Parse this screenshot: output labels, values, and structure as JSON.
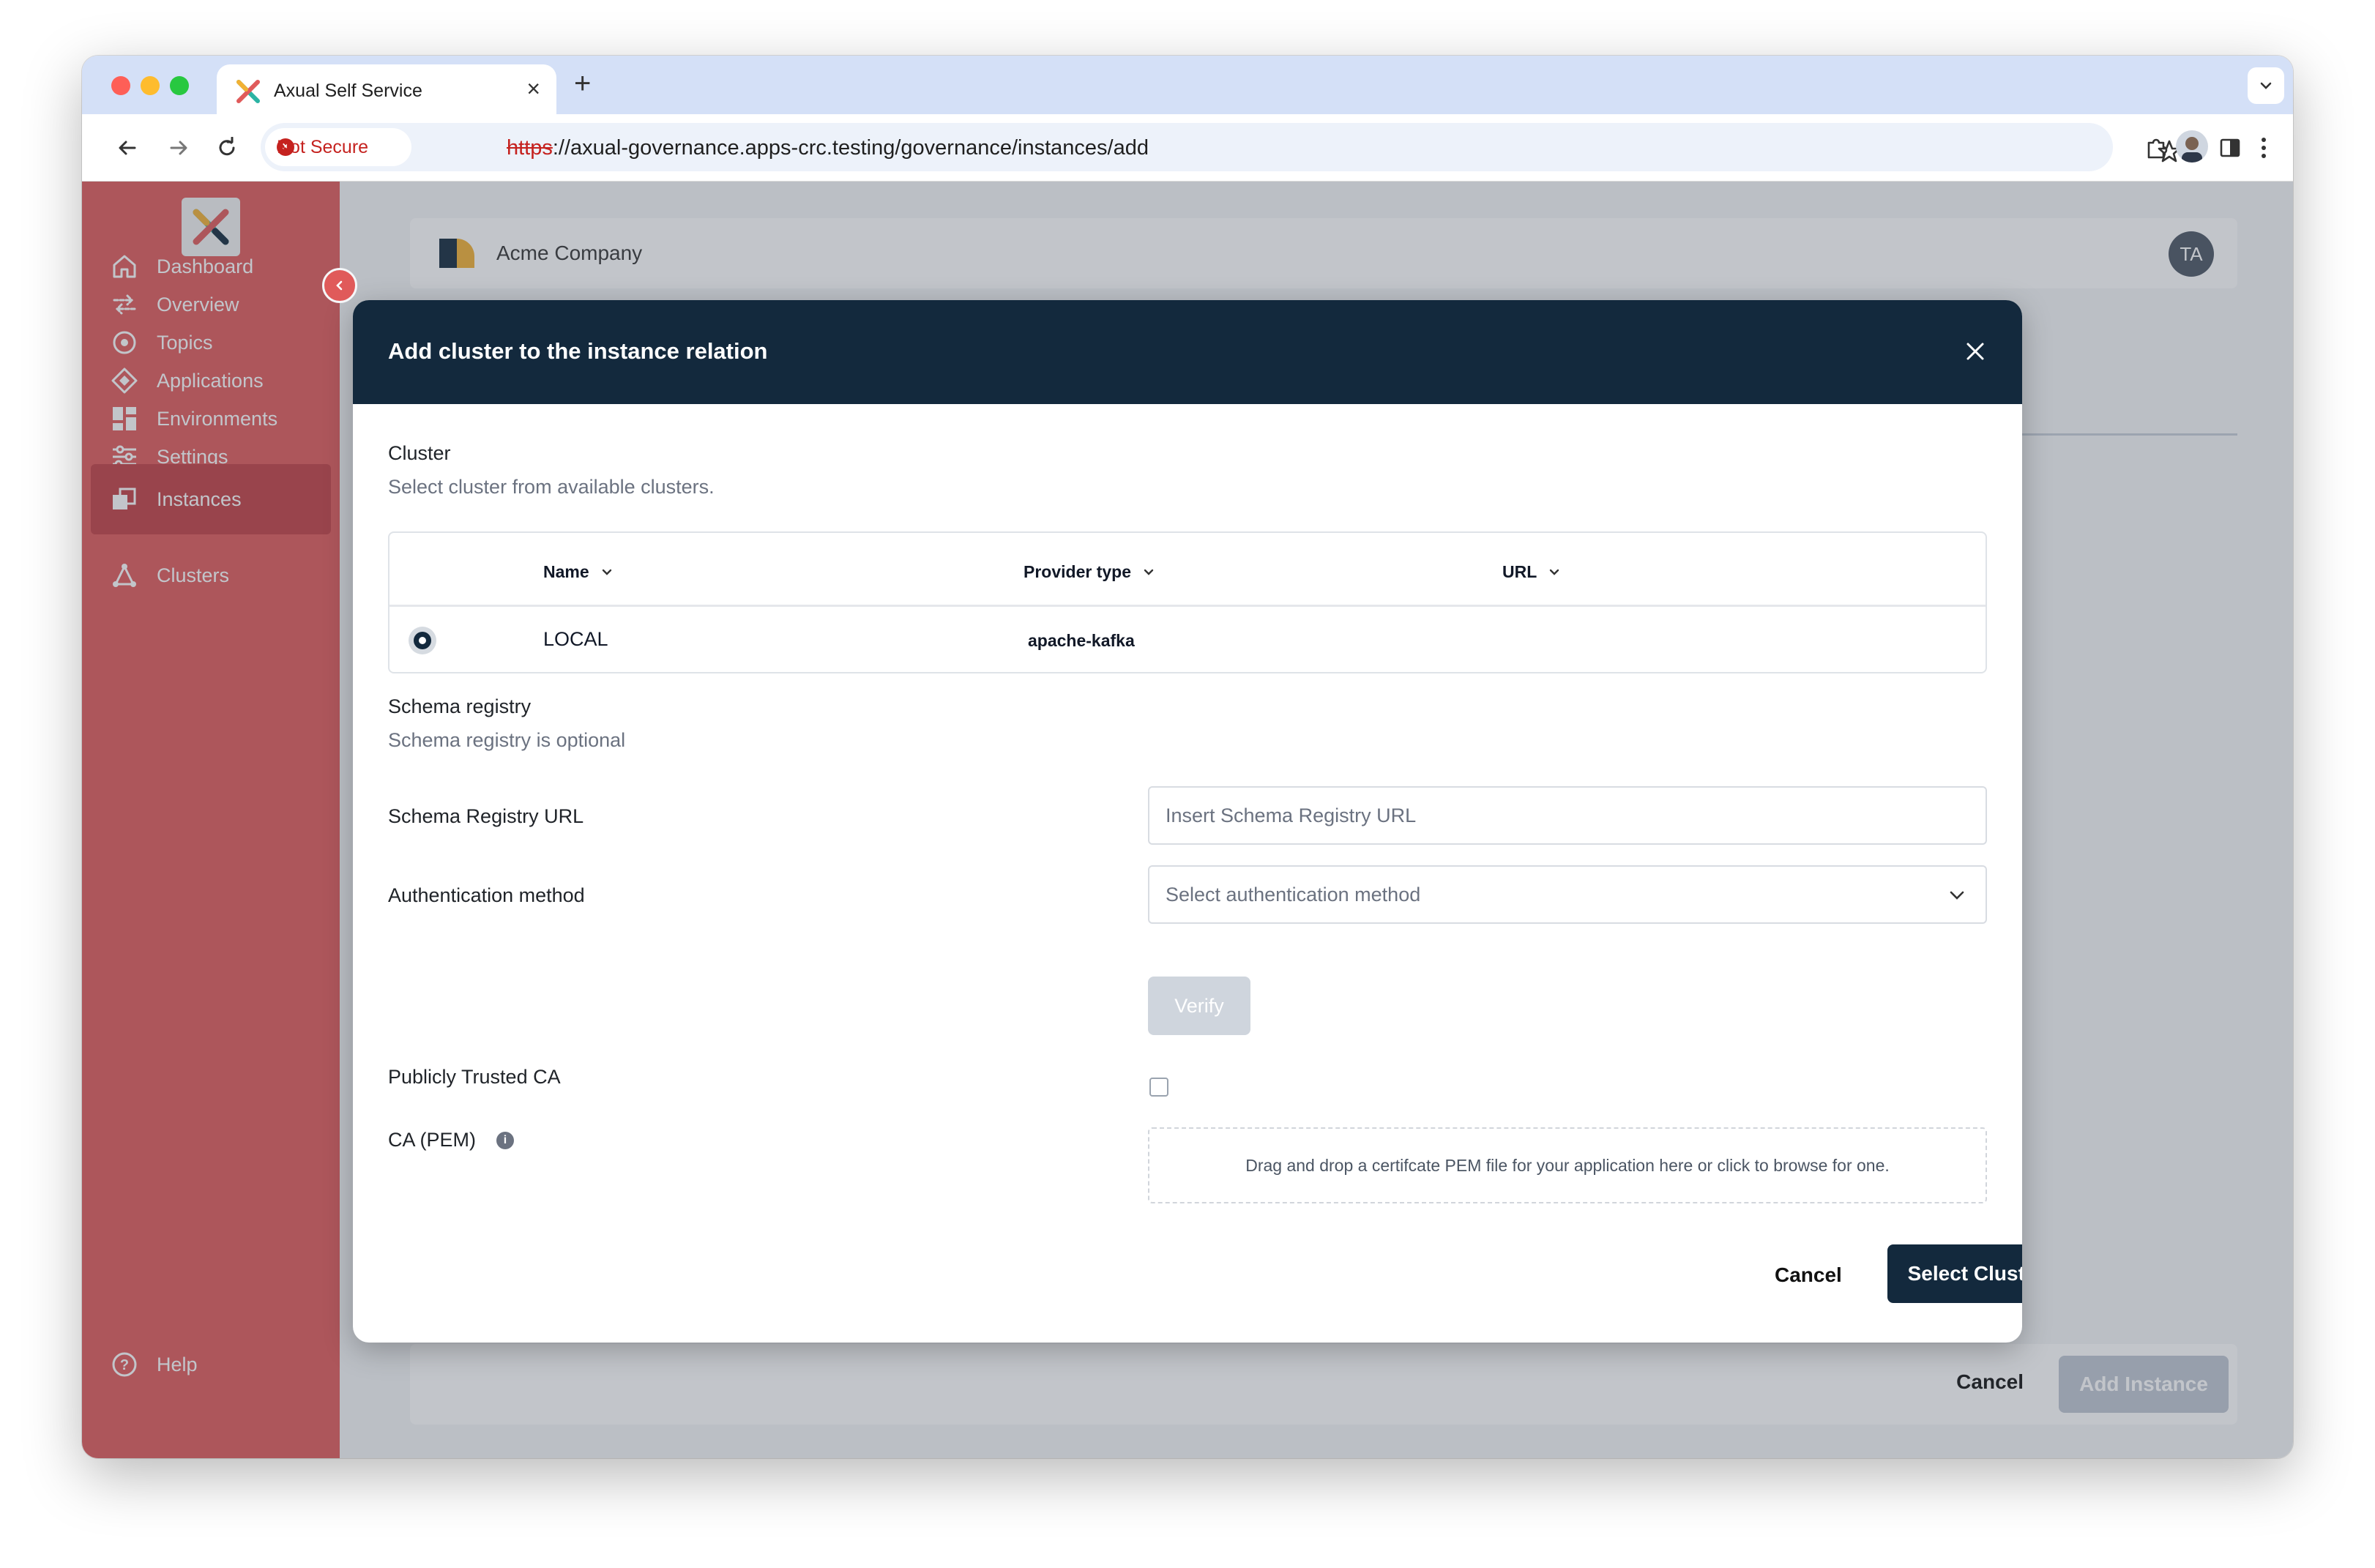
{
  "browser": {
    "tab_title": "Axual Self Service",
    "security_label": "Not Secure",
    "url_scheme": "https",
    "url_rest": "://axual-governance.apps-crc.testing/governance/instances/add"
  },
  "sidebar": {
    "items": [
      {
        "label": "Dashboard",
        "icon": "home-icon"
      },
      {
        "label": "Overview",
        "icon": "overview-icon"
      },
      {
        "label": "Topics",
        "icon": "topics-icon"
      },
      {
        "label": "Applications",
        "icon": "applications-icon"
      },
      {
        "label": "Environments",
        "icon": "environments-icon"
      },
      {
        "label": "Settings",
        "icon": "settings-icon"
      },
      {
        "label": "Instances",
        "icon": "instances-icon",
        "active": true
      },
      {
        "label": "Clusters",
        "icon": "clusters-icon"
      }
    ],
    "help_label": "Help"
  },
  "header": {
    "company": "Acme Company",
    "user_initials": "TA"
  },
  "footer": {
    "cancel_label": "Cancel",
    "add_label": "Add Instance"
  },
  "modal": {
    "title": "Add cluster to the instance relation",
    "cluster_label": "Cluster",
    "cluster_hint": "Select cluster from available clusters.",
    "table": {
      "columns": [
        "Name",
        "Provider type",
        "URL"
      ],
      "rows": [
        {
          "name": "LOCAL",
          "provider": "apache-kafka",
          "url": ""
        }
      ]
    },
    "schema_label": "Schema registry",
    "schema_hint": "Schema registry is optional",
    "schema_url_label": "Schema Registry URL",
    "schema_url_placeholder": "Insert Schema Registry URL",
    "auth_label": "Authentication method",
    "auth_placeholder": "Select authentication method",
    "verify_label": "Verify",
    "public_ca_label": "Publicly Trusted CA",
    "ca_pem_label": "CA (PEM)",
    "dropzone_text": "Drag and drop a certifcate PEM file for your application here or click to browse for one.",
    "cancel_label": "Cancel",
    "select_label": "Select Cluster"
  },
  "colors": {
    "sidebar": "#e05a5a",
    "sidebar_active": "#c23f43",
    "modal_header": "#13293d",
    "primary_button": "#13293d"
  }
}
